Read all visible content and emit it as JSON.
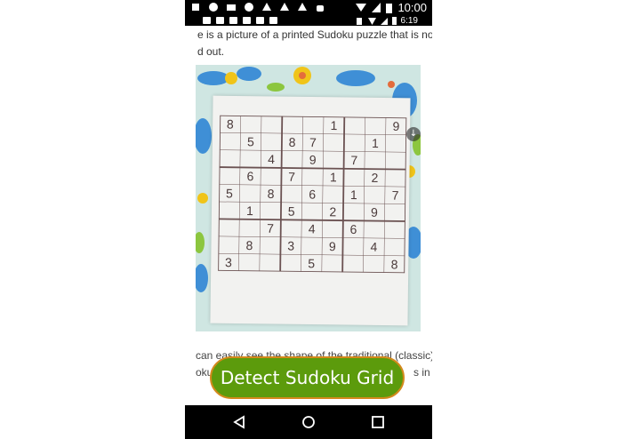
{
  "status_outer": {
    "time": "10:00"
  },
  "status_inner": {
    "time": "6:19"
  },
  "article": {
    "line1": "e is a picture of a printed Sudoku puzzle that is not",
    "line2": "d out.",
    "line3": "can easily see the shape of the traditional (classic)",
    "line4": "oku",
    "line4_tail": "s in"
  },
  "sudoku": [
    [
      "8",
      "",
      "",
      "",
      "",
      "1",
      "",
      "",
      "9"
    ],
    [
      "",
      "5",
      "",
      "8",
      "7",
      "",
      "",
      "1",
      ""
    ],
    [
      "",
      "",
      "4",
      "",
      "9",
      "",
      "7",
      "",
      ""
    ],
    [
      "",
      "6",
      "",
      "7",
      "",
      "1",
      "",
      "2",
      ""
    ],
    [
      "5",
      "",
      "8",
      "",
      "6",
      "",
      "1",
      "",
      "7"
    ],
    [
      "",
      "1",
      "",
      "5",
      "",
      "2",
      "",
      "9",
      ""
    ],
    [
      "",
      "",
      "7",
      "",
      "4",
      "",
      "6",
      "",
      ""
    ],
    [
      "",
      "8",
      "",
      "3",
      "",
      "9",
      "",
      "4",
      ""
    ],
    [
      "3",
      "",
      "",
      "",
      "5",
      "",
      "",
      "",
      "8"
    ]
  ],
  "detect_button": {
    "label": "Detect Sudoku Grid"
  },
  "icons": [
    "download-icon",
    "back-icon",
    "home-icon",
    "recents-icon"
  ]
}
